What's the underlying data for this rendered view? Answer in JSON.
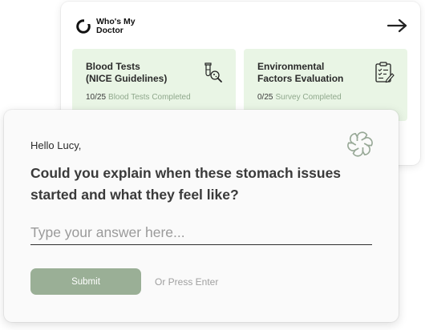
{
  "brand": {
    "name": "Who's My Doctor",
    "logo_icon": "ring-logo-icon"
  },
  "header": {
    "next_icon": "arrow-right-icon"
  },
  "cards": [
    {
      "title": "Blood Tests\n(NICE Guidelines)",
      "count": "10/25",
      "status": "Blood Tests Completed",
      "icon": "test-tube-magnifier-icon"
    },
    {
      "title": "Environmental\nFactors Evaluation",
      "count": "0/25",
      "status": "Survey Completed",
      "icon": "clipboard-checklist-icon"
    }
  ],
  "chat": {
    "greeting": "Hello Lucy,",
    "question": "Could you explain when these stomach issues started and what they feel like?",
    "input_placeholder": "Type your answer here...",
    "submit_label": "Submit",
    "hint": "Or Press Enter",
    "ai_icon": "openai-logo-icon"
  },
  "colors": {
    "card_bg": "#e9f5e5",
    "accent": "#9aaf96",
    "muted_green_text": "#8fa88c"
  }
}
